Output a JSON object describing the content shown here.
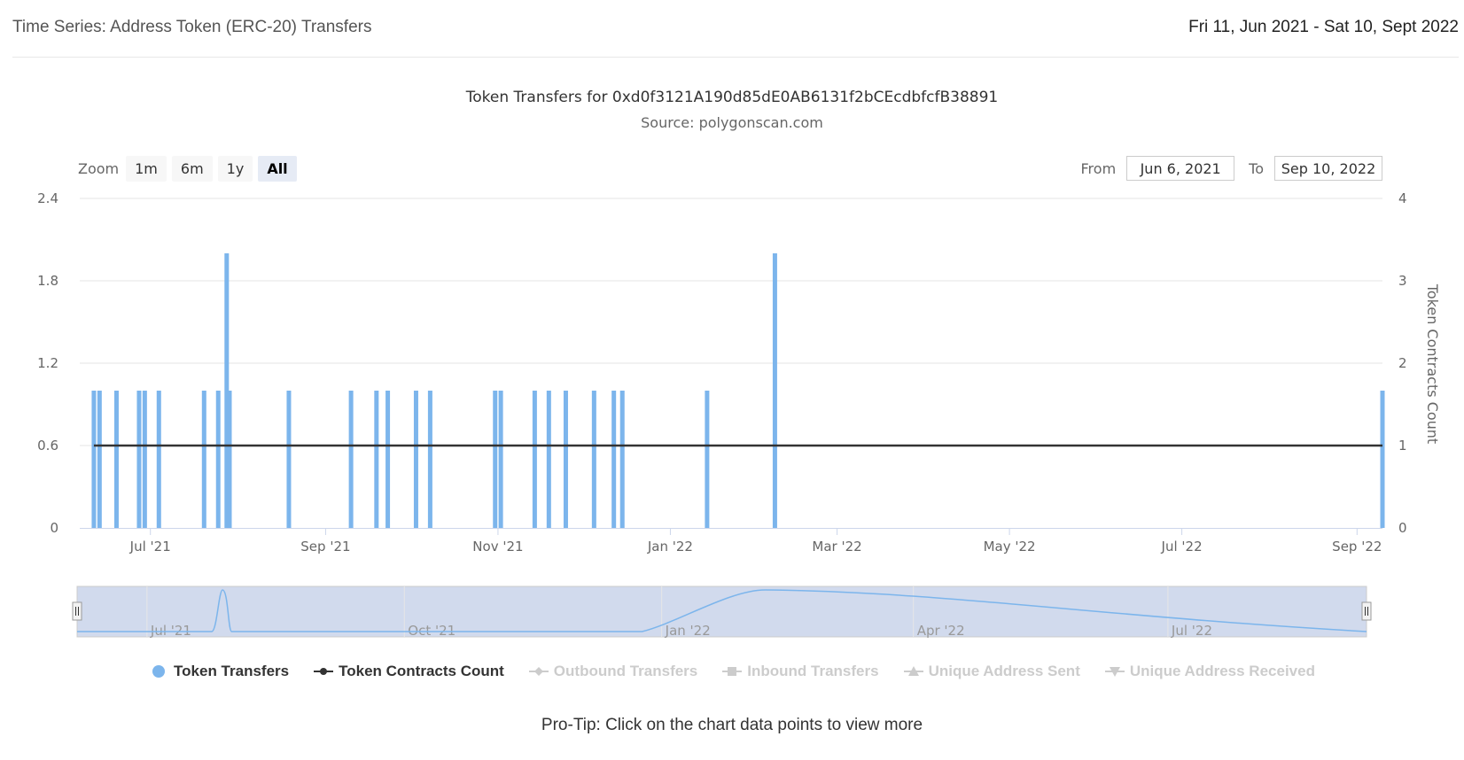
{
  "header": {
    "title": "Time Series: Address Token (ERC-20) Transfers",
    "date_range": "Fri 11, Jun 2021 - Sat 10, Sept 2022"
  },
  "zoom": {
    "label": "Zoom",
    "buttons": [
      "1m",
      "6m",
      "1y",
      "All"
    ],
    "active": "All"
  },
  "range": {
    "from_label": "From",
    "from_value": "Jun 6, 2021",
    "to_label": "To",
    "to_value": "Sep 10, 2022"
  },
  "legend": [
    {
      "name": "Token Transfers",
      "visible": true,
      "color": "#7cb5ec",
      "symbol": "circle"
    },
    {
      "name": "Token Contracts Count",
      "visible": true,
      "color": "#333333",
      "symbol": "circle-line"
    },
    {
      "name": "Outbound Transfers",
      "visible": false,
      "color": "#cccccc",
      "symbol": "diamond-line"
    },
    {
      "name": "Inbound Transfers",
      "visible": false,
      "color": "#cccccc",
      "symbol": "square-line"
    },
    {
      "name": "Unique Address Sent",
      "visible": false,
      "color": "#cccccc",
      "symbol": "triangle-line"
    },
    {
      "name": "Unique Address Received",
      "visible": false,
      "color": "#cccccc",
      "symbol": "triangle-down-line"
    }
  ],
  "protip": "Pro-Tip: Click on the chart data points to view more",
  "chart_data": {
    "type": "bar",
    "title": "Token Transfers for 0xd0f3121A190d85dE0AB6131f2bCEcdbfcfB38891",
    "subtitle": "Source: polygonscan.com",
    "x_range": [
      "2021-06-06",
      "2022-09-10"
    ],
    "x_ticks": [
      {
        "date": "2021-07-01",
        "label": "Jul '21"
      },
      {
        "date": "2021-09-01",
        "label": "Sep '21"
      },
      {
        "date": "2021-11-01",
        "label": "Nov '21"
      },
      {
        "date": "2022-01-01",
        "label": "Jan '22"
      },
      {
        "date": "2022-03-01",
        "label": "Mar '22"
      },
      {
        "date": "2022-05-01",
        "label": "May '22"
      },
      {
        "date": "2022-07-01",
        "label": "Jul '22"
      },
      {
        "date": "2022-09-01",
        "label": "Sep '22"
      }
    ],
    "y_left": {
      "ticks": [
        0,
        0.6,
        1.2,
        1.8,
        2.4
      ],
      "labels": [
        "0",
        "0.6",
        "1.2",
        "1.8",
        "2.4"
      ],
      "range": [
        0,
        2.4
      ]
    },
    "y_right": {
      "ticks": [
        0,
        1,
        2,
        3,
        4
      ],
      "labels": [
        "0",
        "1",
        "2",
        "3",
        "4"
      ],
      "range": [
        0,
        4
      ],
      "label": "Token Contracts Count"
    },
    "grid": true,
    "legend_placement": "bottom",
    "series": [
      {
        "name": "Token Transfers",
        "axis": "left",
        "color": "#7cb5ec",
        "points": [
          {
            "x": "2021-06-11",
            "y": 1
          },
          {
            "x": "2021-06-13",
            "y": 1
          },
          {
            "x": "2021-06-19",
            "y": 1
          },
          {
            "x": "2021-06-27",
            "y": 1
          },
          {
            "x": "2021-06-29",
            "y": 1
          },
          {
            "x": "2021-07-04",
            "y": 1
          },
          {
            "x": "2021-07-20",
            "y": 1
          },
          {
            "x": "2021-07-25",
            "y": 1
          },
          {
            "x": "2021-07-28",
            "y": 2
          },
          {
            "x": "2021-07-29",
            "y": 1
          },
          {
            "x": "2021-08-19",
            "y": 1
          },
          {
            "x": "2021-09-10",
            "y": 1
          },
          {
            "x": "2021-09-19",
            "y": 1
          },
          {
            "x": "2021-09-23",
            "y": 1
          },
          {
            "x": "2021-10-03",
            "y": 1
          },
          {
            "x": "2021-10-08",
            "y": 1
          },
          {
            "x": "2021-10-31",
            "y": 1
          },
          {
            "x": "2021-11-02",
            "y": 1
          },
          {
            "x": "2021-11-14",
            "y": 1
          },
          {
            "x": "2021-11-19",
            "y": 1
          },
          {
            "x": "2021-11-25",
            "y": 1
          },
          {
            "x": "2021-12-05",
            "y": 1
          },
          {
            "x": "2021-12-12",
            "y": 1
          },
          {
            "x": "2021-12-15",
            "y": 1
          },
          {
            "x": "2022-01-14",
            "y": 1
          },
          {
            "x": "2022-02-07",
            "y": 2
          },
          {
            "x": "2022-09-10",
            "y": 1
          }
        ]
      },
      {
        "name": "Token Contracts Count",
        "axis": "right",
        "color": "#333333",
        "points": [
          {
            "x": "2021-06-11",
            "y": 1
          },
          {
            "x": "2022-09-10",
            "y": 1
          }
        ]
      }
    ],
    "navigator": {
      "x_ticks": [
        {
          "date": "2021-07-01",
          "label": "Jul '21"
        },
        {
          "date": "2021-10-01",
          "label": "Oct '21"
        },
        {
          "date": "2022-01-01",
          "label": "Jan '22"
        },
        {
          "date": "2022-04-01",
          "label": "Apr '22"
        },
        {
          "date": "2022-07-01",
          "label": "Jul '22"
        }
      ]
    }
  }
}
